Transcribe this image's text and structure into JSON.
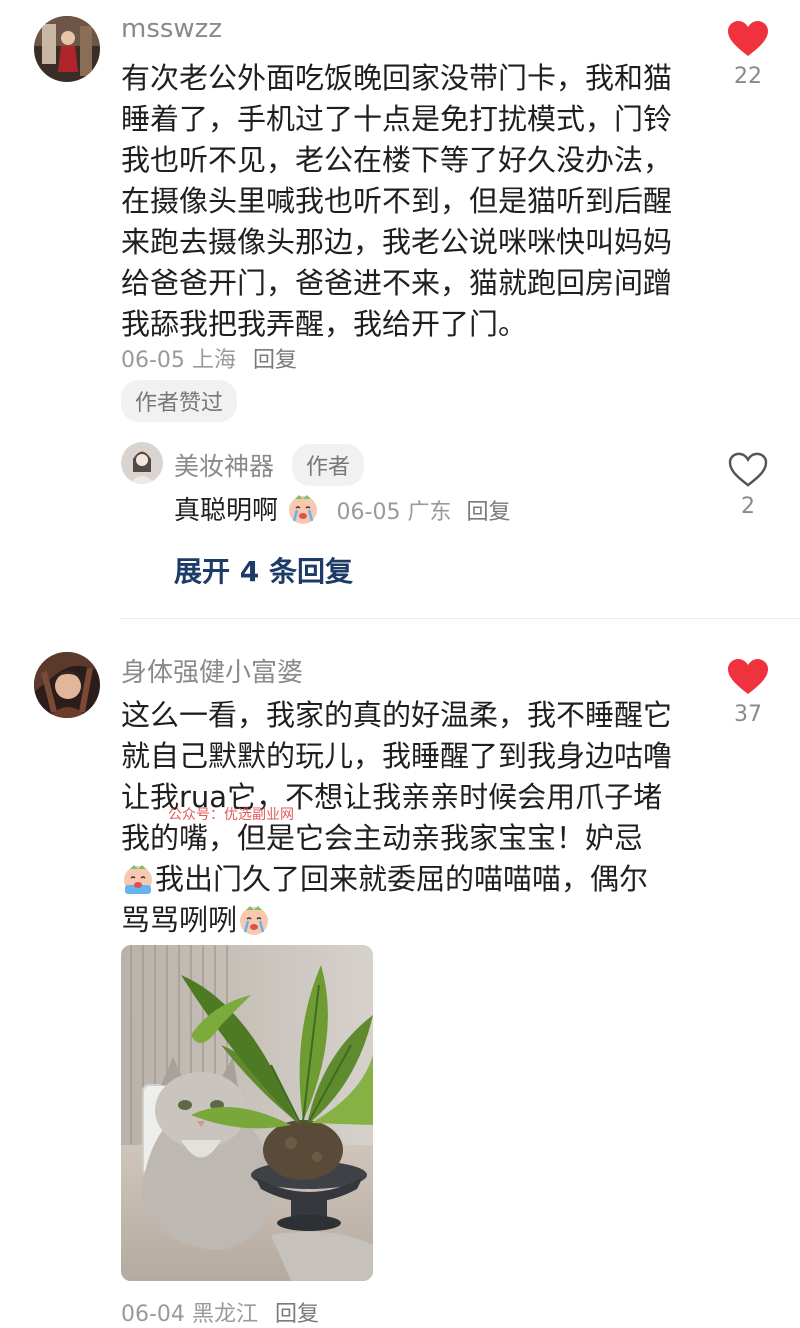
{
  "comments": [
    {
      "username": "msswzz",
      "text": "有次老公外面吃饭晚回家没带门卡，我和猫\n睡着了，手机过了十点是免打扰模式，门铃\n我也听不见，老公在楼下等了好久没办法，\n在摄像头里喊我也听不到，但是猫听到后醒\n来跑去摄像头那边，我老公说咪咪快叫妈妈\n给爸爸开门，爸爸进不来，猫就跑回房间蹭\n我舔我把我弄醒，我给开了门。",
      "date": "06-05",
      "location": "上海",
      "reply_label": "回复",
      "tag": "作者赞过",
      "likes": "22",
      "liked": true,
      "reply": {
        "username": "美妆神器",
        "author_badge": "作者",
        "text": "真聪明啊",
        "date": "06-05",
        "location": "广东",
        "reply_label": "回复",
        "likes": "2",
        "liked": false
      },
      "expand_label": "展开 4 条回复"
    },
    {
      "username": "身体强健小富婆",
      "text_lines": [
        "这么一看，我家的真的好温柔，我不睡醒它",
        "就自己默默的玩儿，我睡醒了到我身边咕噜",
        "让我rua它，不想让我亲亲时候会用爪子堵",
        "我的嘴，但是它会主动亲我家宝宝！妒忌"
      ],
      "text_line5": "我出门久了回来就委屈的喵喵喵，偶尔",
      "text_line6": "骂骂咧咧",
      "date": "06-04",
      "location": "黑龙江",
      "reply_label": "回复",
      "likes": "37",
      "liked": true
    }
  ],
  "watermark": "公众号：优选副业网",
  "colors": {
    "heart_red": "#f0323f",
    "link_blue": "#1d3b66"
  }
}
